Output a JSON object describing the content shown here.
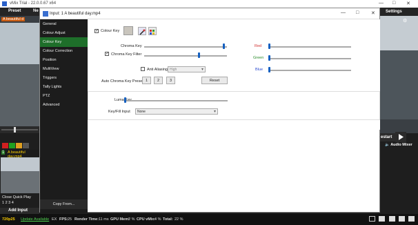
{
  "app": {
    "title": "vMix Trial - 22.0.0.67 x64"
  },
  "menubar": {
    "preset": "Preset",
    "new": "Ne",
    "settings": "Settings"
  },
  "preview_left": {
    "label": "A beautiful d"
  },
  "dialog": {
    "title": "Input: 1 A beautiful day.mp4",
    "sidebar": [
      {
        "label": "General"
      },
      {
        "label": "Colour Adjust"
      },
      {
        "label": "Colour Key"
      },
      {
        "label": "Colour Correction"
      },
      {
        "label": "Position"
      },
      {
        "label": "MultiView"
      },
      {
        "label": "Triggers"
      },
      {
        "label": "Tally Lights"
      },
      {
        "label": "PTZ"
      },
      {
        "label": "Advanced"
      }
    ],
    "copy_from": "Copy From...",
    "colour_key": {
      "label": "Colour Key",
      "checked": true,
      "swatch": "#c9c5bd"
    },
    "chroma_key": {
      "label": "Chroma Key",
      "value": 1.0
    },
    "chroma_key_filter": {
      "label": "Chroma Key Filter",
      "checked": true,
      "value": 0.55
    },
    "anti_aliasing": {
      "label": "Anti Aliasing",
      "checked": false,
      "selected": "High"
    },
    "presets": {
      "label": "Auto Chroma Key Presets",
      "buttons": [
        "1",
        "2",
        "3"
      ],
      "reset": "Reset"
    },
    "rgb": [
      {
        "label": "Red",
        "color": "#d03030",
        "value": 0.0
      },
      {
        "label": "Green",
        "color": "#2a8a2a",
        "value": 0.0
      },
      {
        "label": "Blue",
        "color": "#2a4ad0",
        "value": 0.0
      }
    ],
    "luma_key": {
      "label": "Luma Key",
      "value": 0.0
    },
    "key_fill": {
      "label": "Key/Fill Input",
      "selected": "None"
    }
  },
  "lower_left": {
    "input_number": "1",
    "input_name": "A beautiful day.mp4",
    "close_quickplay": "Close   Quick Play",
    "numbers": "1    2    3    4",
    "add_input": "Add Input"
  },
  "lower_right": {
    "restart": "estart",
    "audio_mixer": "Audio Mixer"
  },
  "status": {
    "resolution": "720p25",
    "update": "Update Available",
    "ex": "EX",
    "fps_label": "FPS:",
    "fps": "25",
    "render_label": "Render Time:",
    "render": "11 ms",
    "gpu_label": "GPU Mem:",
    "gpu": "2 %",
    "cpu_label": "CPU vMix:",
    "cpu": "4 %",
    "total_label": "Total:",
    "total": "22 %"
  },
  "colors": {
    "accent_green": "#1e6f2a",
    "accent_blue": "#1560c0",
    "status_green": "#4fd04f",
    "preset_orange": "#c85a10"
  }
}
